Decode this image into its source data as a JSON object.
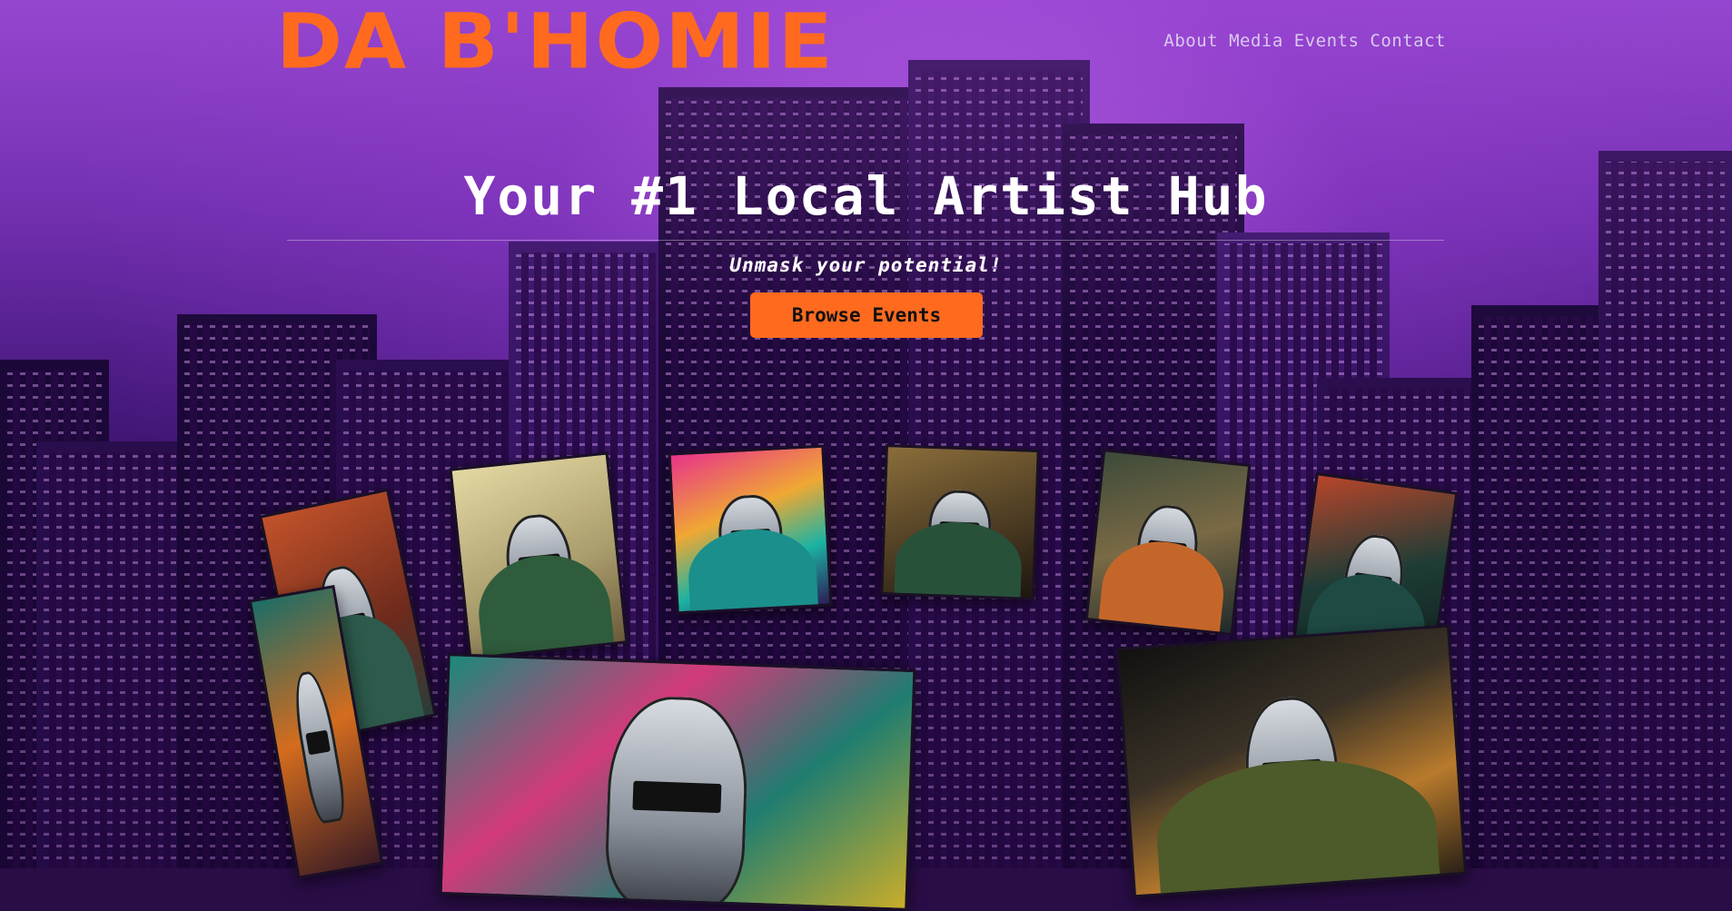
{
  "brand": {
    "logo_text": "DA B'HOMIE",
    "accent_color": "#ff6a1f"
  },
  "nav": {
    "items": [
      {
        "label": "About"
      },
      {
        "label": "Media"
      },
      {
        "label": "Events"
      },
      {
        "label": "Contact"
      }
    ]
  },
  "hero": {
    "title": "Your #1 Local Artist Hub",
    "tagline": "Unmask your potential!",
    "cta_label": "Browse Events"
  },
  "gallery": {
    "images": [
      {
        "icon": "masked-artist-image"
      },
      {
        "icon": "masked-artist-image"
      },
      {
        "icon": "masked-artist-image"
      },
      {
        "icon": "masked-artist-image"
      },
      {
        "icon": "masked-artist-image"
      },
      {
        "icon": "masked-artist-image"
      },
      {
        "icon": "masked-artist-image"
      },
      {
        "icon": "masked-artist-image"
      },
      {
        "icon": "masked-artist-image"
      }
    ]
  }
}
